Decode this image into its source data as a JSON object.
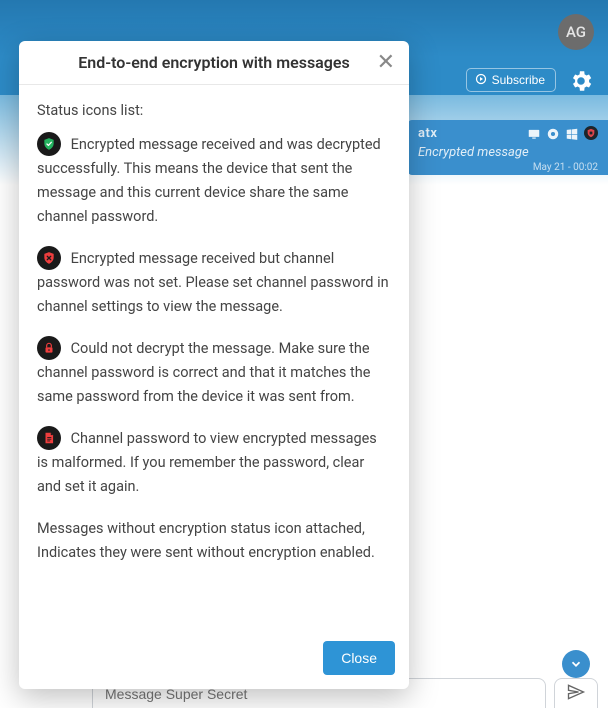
{
  "header": {
    "avatar_initials": "AG",
    "subscribe_label": "Subscribe"
  },
  "channel": {
    "title_suffix": "atx",
    "subtitle": "Encrypted message",
    "timestamp": "May 21 - 00:02"
  },
  "compose": {
    "placeholder": "Message Super Secret"
  },
  "modal": {
    "title": "End-to-end encryption with messages",
    "status_heading": "Status icons list:",
    "items": [
      {
        "icon": "shield-check-green",
        "text": "Encrypted message received and was decrypted successfully. This means the device that sent the message and this current device share the same channel password."
      },
      {
        "icon": "shield-x-red",
        "text": "Encrypted message received but channel password was not set. Please set channel password in channel settings to view the message."
      },
      {
        "icon": "lock-red",
        "text": "Could not decrypt the message. Make sure the channel password is correct and that it matches the same password from the device it was sent from."
      },
      {
        "icon": "note-red",
        "text": "Channel password to view encrypted messages is malformed. If you remember the password, clear and set it again."
      }
    ],
    "no_icon_note": "Messages without encryption status icon attached, Indicates they were sent without encryption enabled.",
    "close_label": "Close"
  }
}
